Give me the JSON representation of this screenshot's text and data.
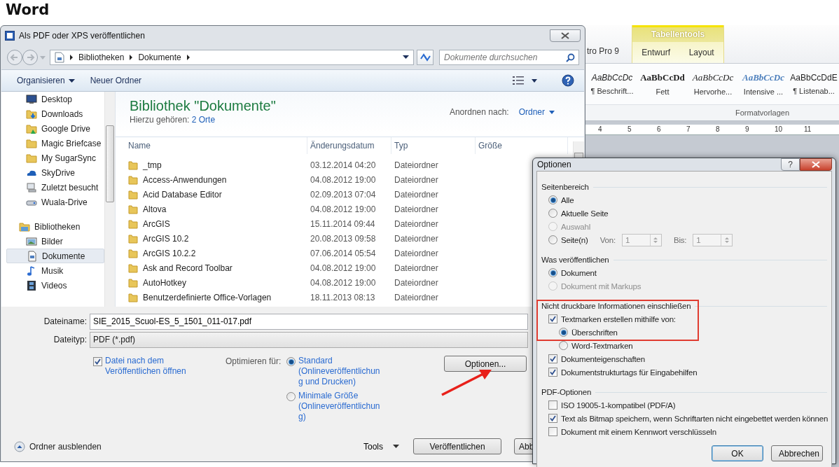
{
  "heading": "Word",
  "word_ribbon": {
    "partial_tab": "tro Pro 9",
    "context_group": "Tabellentools",
    "context_tabs": [
      {
        "label": "Entwurf",
        "selected": false
      },
      {
        "label": "Layout",
        "selected": false
      }
    ],
    "styles": [
      {
        "preview": "AaBbCcDc",
        "label": "¶ Beschrift...",
        "kind": "caption"
      },
      {
        "preview": "AaBbCcDd",
        "label": "Fett",
        "kind": "bold"
      },
      {
        "preview": "AaBbCcDc",
        "label": "Hervorhe...",
        "kind": "emphasis"
      },
      {
        "preview": "AaBbCcDc",
        "label": "Intensive ...",
        "kind": "intense"
      },
      {
        "preview": "AaBbCcDdE",
        "label": "¶ Listenab...",
        "kind": "plain"
      }
    ],
    "group_label": "Formatvorlagen",
    "ruler": [
      "4",
      "5",
      "6",
      "7",
      "8",
      "9",
      "10",
      "11"
    ]
  },
  "save_dialog": {
    "title": "Als PDF oder XPS veröffentlichen",
    "breadcrumb": [
      "Bibliotheken",
      "Dokumente"
    ],
    "search": {
      "placeholder": "Dokumente durchsuchen"
    },
    "toolbar": {
      "organize": "Organisieren",
      "new_folder": "Neuer Ordner"
    },
    "sidebar": {
      "favorites": [
        {
          "label": "Desktop",
          "kind": "desktop",
          "selected": false
        },
        {
          "label": "Downloads",
          "kind": "download",
          "selected": false
        },
        {
          "label": "Google Drive",
          "kind": "gdrive",
          "selected": false
        },
        {
          "label": "Magic Briefcase",
          "kind": "folder",
          "selected": false
        },
        {
          "label": "My SugarSync",
          "kind": "folder",
          "selected": false
        },
        {
          "label": "SkyDrive",
          "kind": "cloud",
          "selected": false
        },
        {
          "label": "Zuletzt besucht",
          "kind": "recent",
          "selected": false
        },
        {
          "label": "Wuala-Drive",
          "kind": "drive",
          "selected": false
        }
      ],
      "libraries": {
        "label": "Bibliotheken",
        "kind": "library",
        "selected": false,
        "children": [
          {
            "label": "Bilder",
            "kind": "pictures",
            "selected": false
          },
          {
            "label": "Dokumente",
            "kind": "documents",
            "selected": true
          },
          {
            "label": "Musik",
            "kind": "music",
            "selected": false
          },
          {
            "label": "Videos",
            "kind": "videos",
            "selected": false
          }
        ]
      }
    },
    "library": {
      "title": "Bibliothek \"Dokumente\"",
      "includes_label": "Hierzu gehören:",
      "includes_link": "2 Orte",
      "arrange_label": "Anordnen nach:",
      "arrange_value": "Ordner"
    },
    "columns": [
      "Name",
      "Änderungsdatum",
      "Typ",
      "Größe"
    ],
    "rows": [
      {
        "name": "_tmp",
        "modified": "03.12.2014 04:20",
        "type": "Dateiordner"
      },
      {
        "name": "Access-Anwendungen",
        "modified": "04.08.2012 19:00",
        "type": "Dateiordner"
      },
      {
        "name": "Acid Database Editor",
        "modified": "02.09.2013 07:04",
        "type": "Dateiordner"
      },
      {
        "name": "Altova",
        "modified": "04.08.2012 19:00",
        "type": "Dateiordner"
      },
      {
        "name": "ArcGIS",
        "modified": "15.11.2014 09:44",
        "type": "Dateiordner"
      },
      {
        "name": "ArcGIS 10.2",
        "modified": "20.08.2013 09:58",
        "type": "Dateiordner"
      },
      {
        "name": "ArcGIS 10.2.2",
        "modified": "07.06.2014 05:54",
        "type": "Dateiordner"
      },
      {
        "name": "Ask and Record Toolbar",
        "modified": "04.08.2012 19:00",
        "type": "Dateiordner"
      },
      {
        "name": "AutoHotkey",
        "modified": "04.08.2012 19:00",
        "type": "Dateiordner"
      },
      {
        "name": "Benutzerdefinierte Office-Vorlagen",
        "modified": "18.11.2013 08:13",
        "type": "Dateiordner"
      }
    ],
    "filename_label": "Dateiname:",
    "filename": "SIE_2015_Scuol-ES_5_1501_011-017.pdf",
    "filetype_label": "Dateityp:",
    "filetype": "PDF (*.pdf)",
    "open_after": {
      "label": "Datei nach dem Veröffentlichen öffnen",
      "checked": true
    },
    "optimize_label": "Optimieren für:",
    "optimize": [
      {
        "label": "Standard (Onlineveröffentlichung und Drucken)",
        "selected": true
      },
      {
        "label": "Minimale Größe (Onlineveröffentlichung)",
        "selected": false
      }
    ],
    "options_button": "Optionen...",
    "hide_folders": "Ordner ausblenden",
    "tools": "Tools",
    "publish": "Veröffentlichen",
    "cancel": "Abb"
  },
  "options_dialog": {
    "title": "Optionen",
    "help": "?",
    "sections": [
      {
        "title": "Seitenbereich",
        "items": [
          {
            "kind": "radio",
            "label": "Alle",
            "selected": true,
            "disabled": false
          },
          {
            "kind": "radio",
            "label": "Aktuelle Seite",
            "selected": false,
            "disabled": false
          },
          {
            "kind": "radio",
            "label": "Auswahl",
            "selected": false,
            "disabled": true
          },
          {
            "kind": "radio",
            "label": "Seite(n)",
            "selected": false,
            "disabled": false,
            "range": {
              "from_label": "Von:",
              "from": "1",
              "to_label": "Bis:",
              "to": "1"
            }
          }
        ]
      },
      {
        "title": "Was veröffentlichen",
        "items": [
          {
            "kind": "radio",
            "label": "Dokument",
            "selected": true,
            "disabled": false
          },
          {
            "kind": "radio",
            "label": "Dokument mit Markups",
            "selected": false,
            "disabled": true
          }
        ]
      },
      {
        "title": "Nicht druckbare Informationen einschließen",
        "items": [
          {
            "kind": "checkbox",
            "label": "Textmarken erstellen mithilfe von:",
            "checked": true,
            "children": [
              {
                "kind": "radio",
                "label": "Überschriften",
                "selected": true,
                "disabled": false
              },
              {
                "kind": "radio",
                "label": "Word-Textmarken",
                "selected": false,
                "disabled": false
              }
            ]
          },
          {
            "kind": "checkbox",
            "label": "Dokumenteigenschaften",
            "checked": true
          },
          {
            "kind": "checkbox",
            "label": "Dokumentstrukturtags für Eingabehilfen",
            "checked": true
          }
        ]
      },
      {
        "title": "PDF-Optionen",
        "items": [
          {
            "kind": "checkbox",
            "label": "ISO 19005-1-kompatibel (PDF/A)",
            "checked": false
          },
          {
            "kind": "checkbox",
            "label": "Text als Bitmap speichern, wenn Schriftarten nicht eingebettet werden können",
            "checked": true
          },
          {
            "kind": "checkbox",
            "label": "Dokument mit einem Kennwort verschlüsseln",
            "checked": false
          }
        ]
      }
    ],
    "buttons": [
      "OK",
      "Abbrechen"
    ]
  },
  "annotations": {
    "highlight_frame": true,
    "arrow": true
  }
}
